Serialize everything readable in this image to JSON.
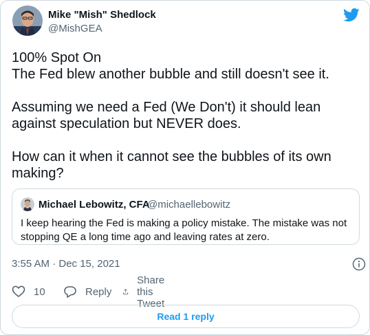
{
  "author": {
    "name": "Mike \"Mish\" Shedlock",
    "handle": "@MishGEA"
  },
  "tweet": {
    "paragraphs": [
      "100% Spot On\nThe Fed blew another bubble and still doesn't see it.",
      "Assuming we need a Fed (We Don't) it should lean against speculation but NEVER does.",
      "How can it when it cannot see the bubbles of its own making?"
    ]
  },
  "quote": {
    "name": "Michael Lebowitz, CFA",
    "handle": "@michaellebowitz",
    "text": "I keep hearing the Fed is making a policy mistake. The mistake was not stopping QE a long time ago and leaving rates at zero."
  },
  "timestamp": "3:55 AM · Dec 15, 2021",
  "actions": {
    "like_count": "10",
    "reply_label": "Reply",
    "share_label": "Share this Tweet"
  },
  "read_replies_label": "Read 1 reply",
  "colors": {
    "accent": "#1d9bf0",
    "muted": "#536471",
    "border": "#cfd9de"
  },
  "icons": [
    "twitter-logo-icon",
    "info-icon",
    "heart-icon",
    "reply-icon",
    "share-icon"
  ]
}
